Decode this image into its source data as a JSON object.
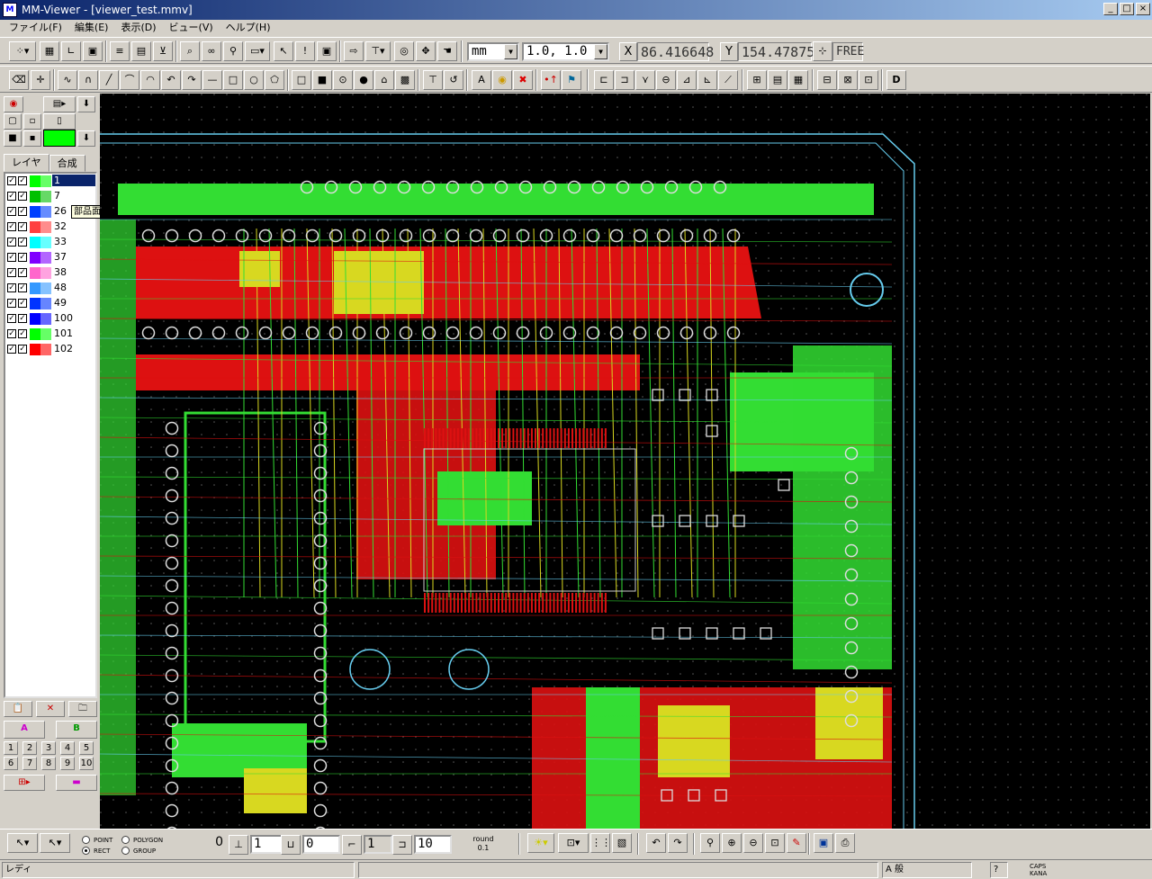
{
  "window": {
    "app_name": "MM-Viewer",
    "title": "MM-Viewer - [viewer_test.mmv]",
    "minimize": "_",
    "restore": "□",
    "close": "×"
  },
  "menu": [
    "ファイル(F)",
    "編集(E)",
    "表示(D)",
    "ビュー(V)",
    "ヘルプ(H)"
  ],
  "toolbar1": {
    "unit": "mm",
    "grid": "1.0, 1.0",
    "x_label": "X",
    "x_value": "86.416648",
    "y_label": "Y",
    "y_value": "154.478753",
    "snap_mode": "FREE"
  },
  "left_panel": {
    "tabs": [
      "レイヤ",
      "合成"
    ],
    "active_tab": 0,
    "active_color": "#00ff00",
    "tooltip": "部品面 0",
    "layers": [
      {
        "num": "1",
        "color": "#00ff00",
        "selected": true
      },
      {
        "num": "7",
        "color": "#00c000",
        "selected": false
      },
      {
        "num": "26",
        "color": "#0040ff",
        "selected": false
      },
      {
        "num": "32",
        "color": "#ff4040",
        "selected": false
      },
      {
        "num": "33",
        "color": "#00ffff",
        "selected": false
      },
      {
        "num": "37",
        "color": "#8000ff",
        "selected": false
      },
      {
        "num": "38",
        "color": "#ff66cc",
        "selected": false
      },
      {
        "num": "48",
        "color": "#3399ff",
        "selected": false
      },
      {
        "num": "49",
        "color": "#0033ff",
        "selected": false
      },
      {
        "num": "100",
        "color": "#0000ff",
        "selected": false
      },
      {
        "num": "101",
        "color": "#00ff00",
        "selected": false
      },
      {
        "num": "102",
        "color": "#ff0000",
        "selected": false
      }
    ],
    "number_buttons": [
      "1",
      "2",
      "3",
      "4",
      "5",
      "6",
      "7",
      "8",
      "9",
      "10"
    ]
  },
  "bottom_toolbar": {
    "radio_point": "POINT",
    "radio_polygon": "POLYGON",
    "radio_rect": "RECT",
    "radio_group": "GROUP",
    "field0": "0",
    "field1": "1",
    "field2": "0",
    "field3": "1",
    "field4": "10",
    "round_label": "round",
    "round_value": "0.1"
  },
  "status": {
    "text": "レディ",
    "caps": "CAPS",
    "kana": "KANA",
    "ime": "A 般"
  },
  "colors": {
    "trace_green": "#33dd33",
    "trace_red": "#dd1111",
    "trace_yellow": "#d8d820",
    "trace_cyan": "#66ccee",
    "background": "#000000"
  }
}
